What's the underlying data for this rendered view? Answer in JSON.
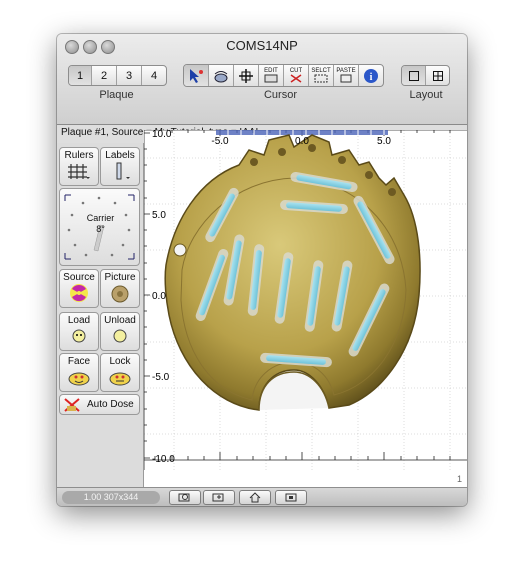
{
  "window": {
    "title": "COMS14NP"
  },
  "plaque_tabs": [
    "1",
    "2",
    "3",
    "4"
  ],
  "plaque_label": "Plaque",
  "cursor_tools": [
    "pointer-tool",
    "move-tool",
    "crosshair-tool",
    "EDIT",
    "CUT",
    "SELECT",
    "PASTE",
    "info-tool"
  ],
  "cursor_labels": {
    "edit": "EDIT",
    "cut": "CUT",
    "select": "SELCT",
    "paste": "PASTE"
  },
  "cursor_label": "Cursor",
  "layout_label": "Layout",
  "info": "Plaque #1, Source = My Tutorial, type = IAAI",
  "panel": {
    "rulers": "Rulers",
    "labels": "Labels",
    "carrier": "Carrier",
    "carrier_angle": "8°",
    "source": "Source",
    "picture": "Picture",
    "load": "Load",
    "unload": "Unload",
    "face": "Face",
    "lock": "Lock",
    "auto_dose": "Auto Dose"
  },
  "ruler": {
    "top_ticks": [
      "-5.0",
      "0.0",
      "5.0"
    ],
    "left_ticks": [
      "10.0",
      "5.0",
      "0.0",
      "-5.0",
      "-10.0"
    ]
  },
  "status": {
    "zoom": "1.00 307x344",
    "page": "1"
  },
  "colors": {
    "seed": "#8fd4e8",
    "plaque": "#c9b35a",
    "accent": "#2b57c9"
  }
}
